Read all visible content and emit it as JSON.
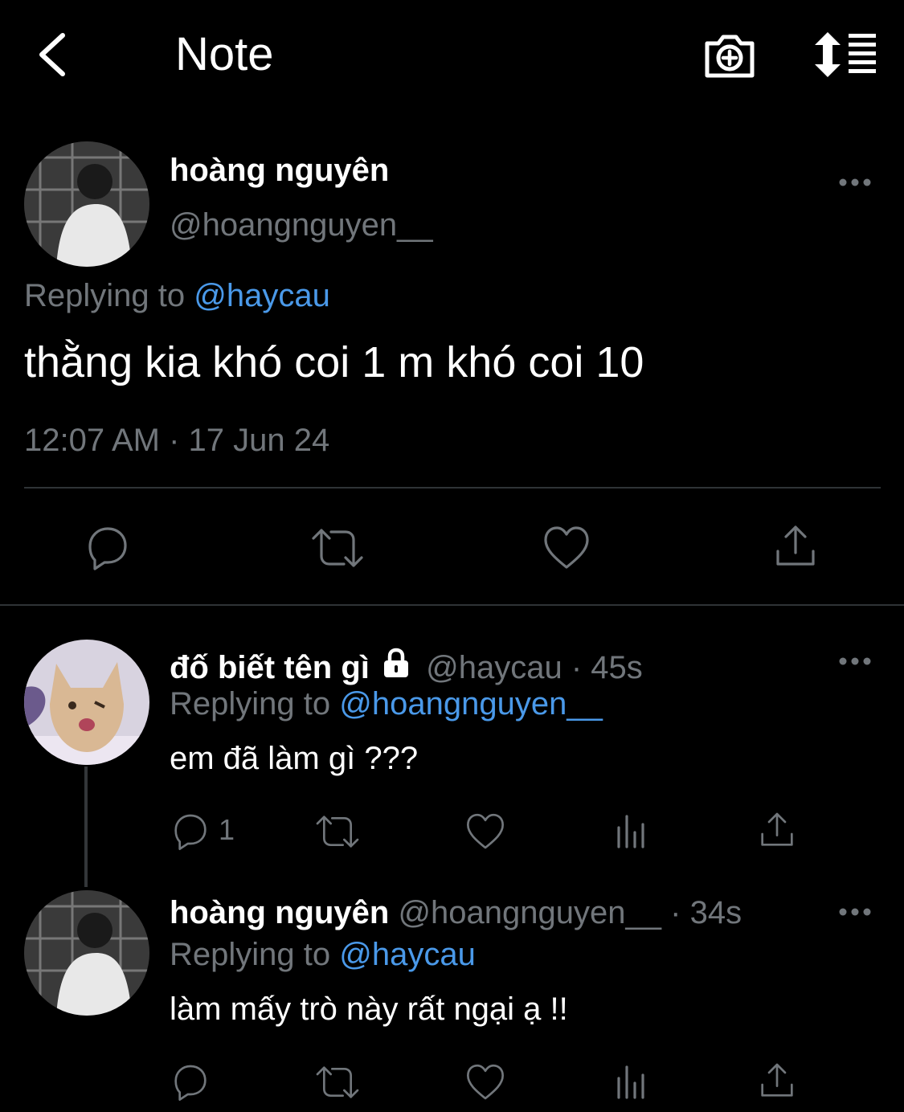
{
  "header": {
    "title": "Note"
  },
  "main_tweet": {
    "display_name": "hoàng nguyên",
    "handle": "@hoangnguyen__",
    "replying_prefix": "Replying to",
    "replying_to": "@haycau",
    "text": "thằng kia khó coi 1 m khó coi 10",
    "timestamp": "12:07 AM · 17 Jun 24"
  },
  "replies": [
    {
      "display_name": "đố biết tên gì",
      "handle": "@haycau",
      "time": "· 45s",
      "replying_prefix": "Replying to",
      "replying_to": "@hoangnguyen__",
      "text": "em đã làm gì ???",
      "reply_count": "1"
    },
    {
      "display_name": "hoàng nguyên",
      "handle": "@hoangnguyen__",
      "time": "· 34s",
      "replying_prefix": "Replying to",
      "replying_to": "@haycau",
      "text": "làm mấy trò này rất ngại ạ !!"
    }
  ],
  "colors": {
    "background": "#000000",
    "link": "#4a99e9",
    "muted": "#71767b",
    "text": "#e7e9ea"
  }
}
